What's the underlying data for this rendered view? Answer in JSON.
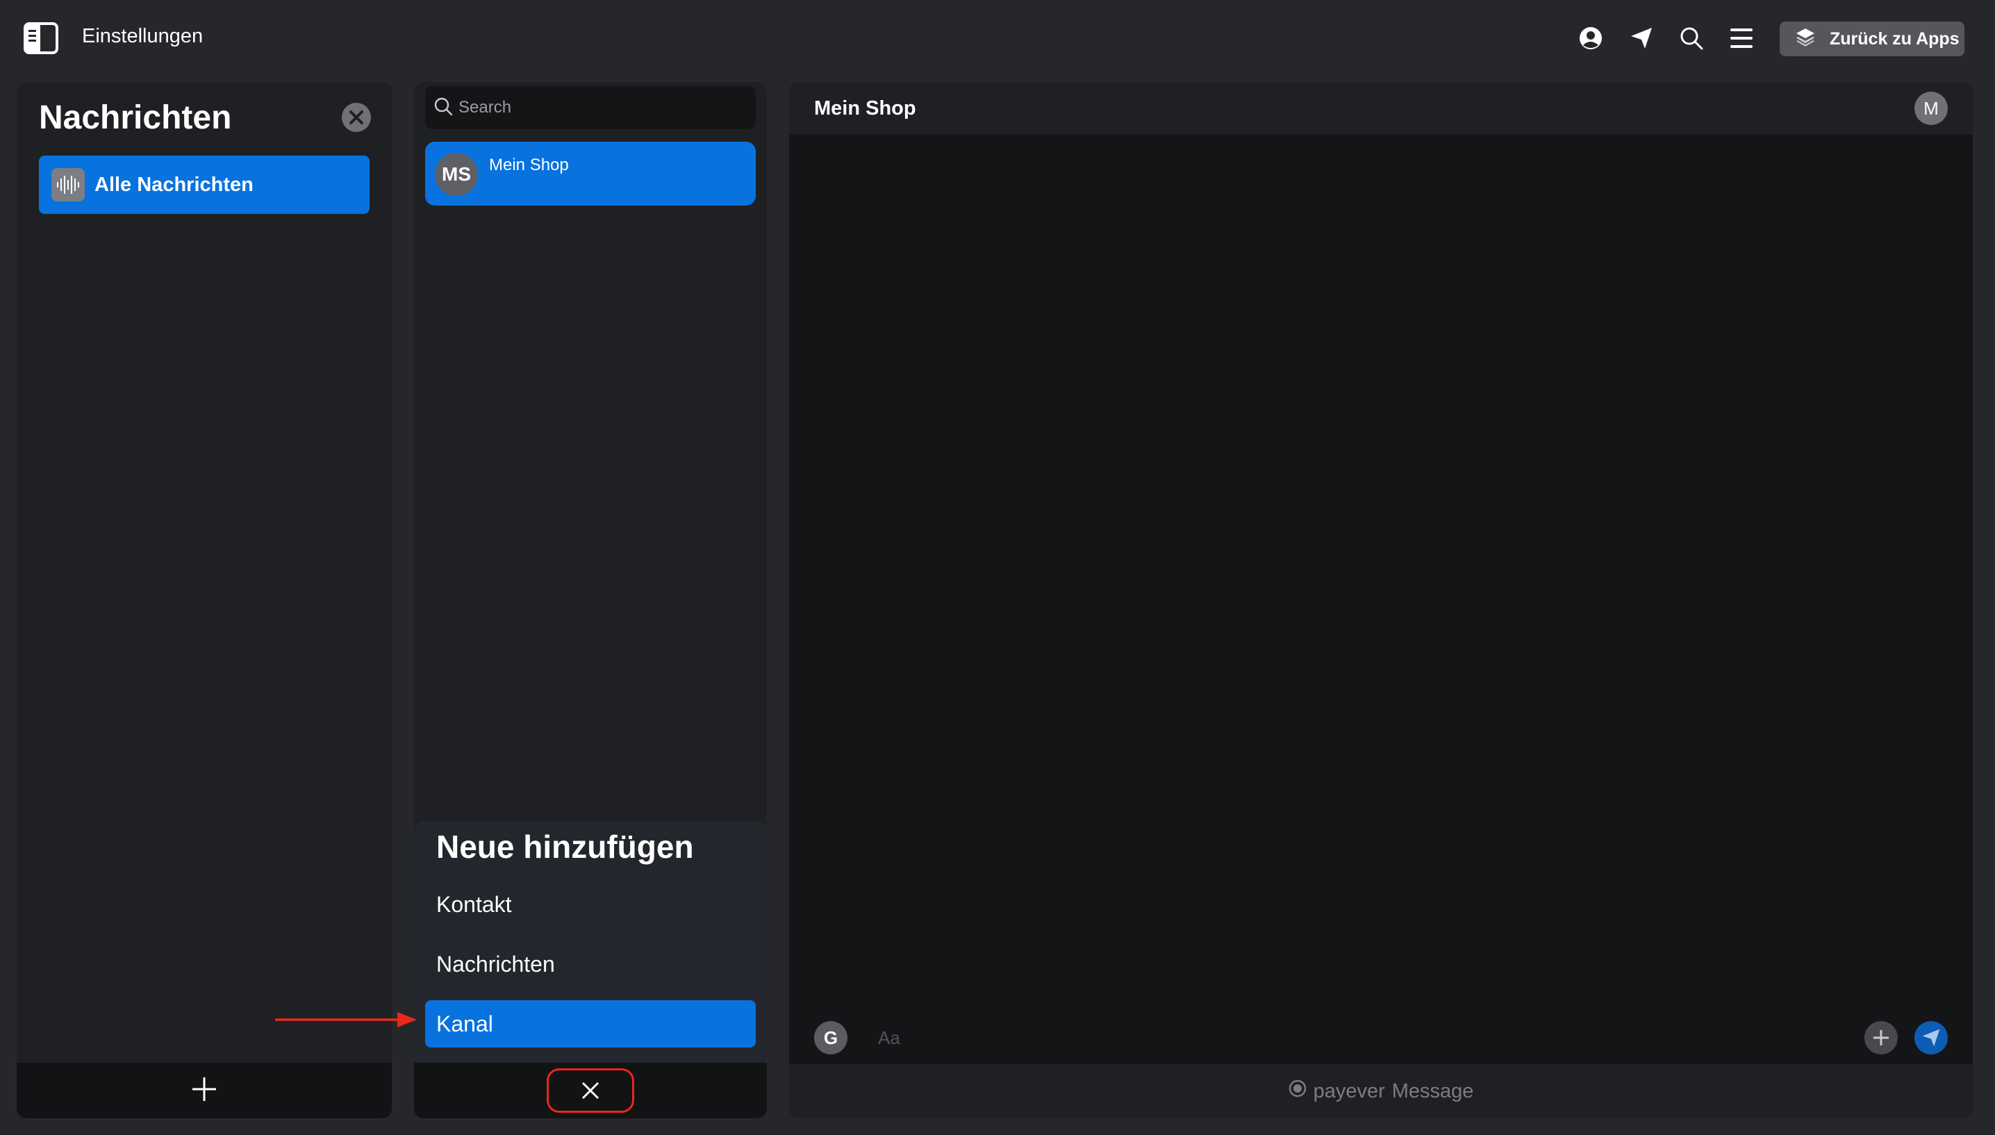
{
  "topbar": {
    "title": "Einstellungen",
    "back_label": "Zurück zu Apps"
  },
  "sidebar": {
    "heading": "Nachrichten",
    "items": [
      {
        "label": "Alle Nachrichten",
        "icon": "voice-wave-icon",
        "selected": true
      }
    ]
  },
  "conversations": {
    "search_placeholder": "Search",
    "items": [
      {
        "avatar": "MS",
        "name": "Mein Shop",
        "selected": true
      }
    ]
  },
  "add_menu": {
    "title": "Neue hinzufügen",
    "options": [
      {
        "label": "Kontakt",
        "selected": false
      },
      {
        "label": "Nachrichten",
        "selected": false
      },
      {
        "label": "Kanal",
        "selected": true
      }
    ]
  },
  "chat": {
    "title": "Mein Shop",
    "user_initial": "M",
    "composer_avatar": "G",
    "composer_placeholder": "Aa",
    "footer_brand": "payever",
    "footer_product": "Message"
  },
  "colors": {
    "accent": "#0872de",
    "background": "#26272b",
    "panel": "#1f2024",
    "highlight_annotation": "#e8281b"
  }
}
